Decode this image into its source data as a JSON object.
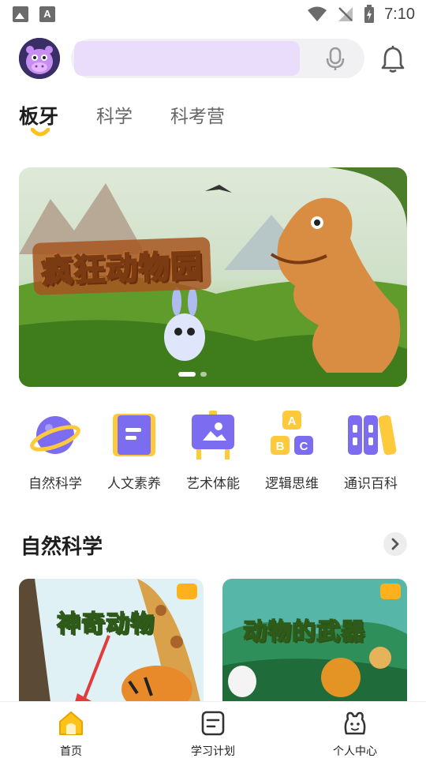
{
  "status_bar": {
    "time": "7:10"
  },
  "header": {
    "search_placeholder": "",
    "icons": [
      "mic-icon",
      "bell-icon"
    ]
  },
  "tabs": [
    {
      "label": "板牙",
      "active": true
    },
    {
      "label": "科学",
      "active": false
    },
    {
      "label": "科考营",
      "active": false
    }
  ],
  "banner": {
    "title": "疯狂动物园",
    "dots": 2,
    "active_dot": 0
  },
  "categories": [
    {
      "label": "自然科学",
      "icon": "planet-icon"
    },
    {
      "label": "人文素养",
      "icon": "book-icon"
    },
    {
      "label": "艺术体能",
      "icon": "easel-icon"
    },
    {
      "label": "逻辑思维",
      "icon": "abc-blocks-icon"
    },
    {
      "label": "通识百科",
      "icon": "books-stack-icon"
    }
  ],
  "section": {
    "title": "自然科学",
    "cards": [
      {
        "title": "神奇动物"
      },
      {
        "title": "动物的武器"
      }
    ]
  },
  "bottom_nav": [
    {
      "label": "首页",
      "icon": "home-icon",
      "active": true
    },
    {
      "label": "学习计划",
      "icon": "plan-icon",
      "active": false
    },
    {
      "label": "个人中心",
      "icon": "profile-icon",
      "active": false
    }
  ],
  "colors": {
    "accent": "#ffc21a",
    "search_fill": "#eadcfb",
    "category_purple": "#7c6cf0",
    "category_yellow": "#ffc93c",
    "annotation_red": "#e23b3b"
  }
}
